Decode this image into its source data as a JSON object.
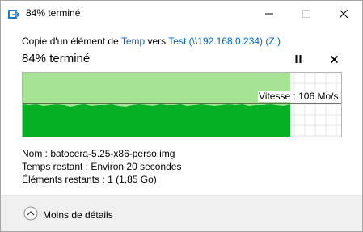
{
  "window": {
    "title": "84% terminé"
  },
  "copy": {
    "prefix": "Copie d'un élément de ",
    "source": "Temp",
    "middle": " vers ",
    "destination": "Test (\\\\192.168.0.234) (Z:)"
  },
  "progress": {
    "heading": "84% terminé",
    "percent": 84,
    "speed_label": "Vitesse : 106 Mo/s"
  },
  "details": {
    "name_label": "Nom :",
    "name_value": "batocera-5.25-x86-perso.img",
    "time_label": "Temps restant :",
    "time_value": "Environ 20 secondes",
    "items_label": "Éléments restants :",
    "items_value": "1 (1,85 Go)"
  },
  "footer": {
    "fewer_details_label": "Moins de détails"
  },
  "colors": {
    "progress_done": "#a6e394",
    "throughput_fill": "#06b025",
    "link": "#0066cc"
  }
}
